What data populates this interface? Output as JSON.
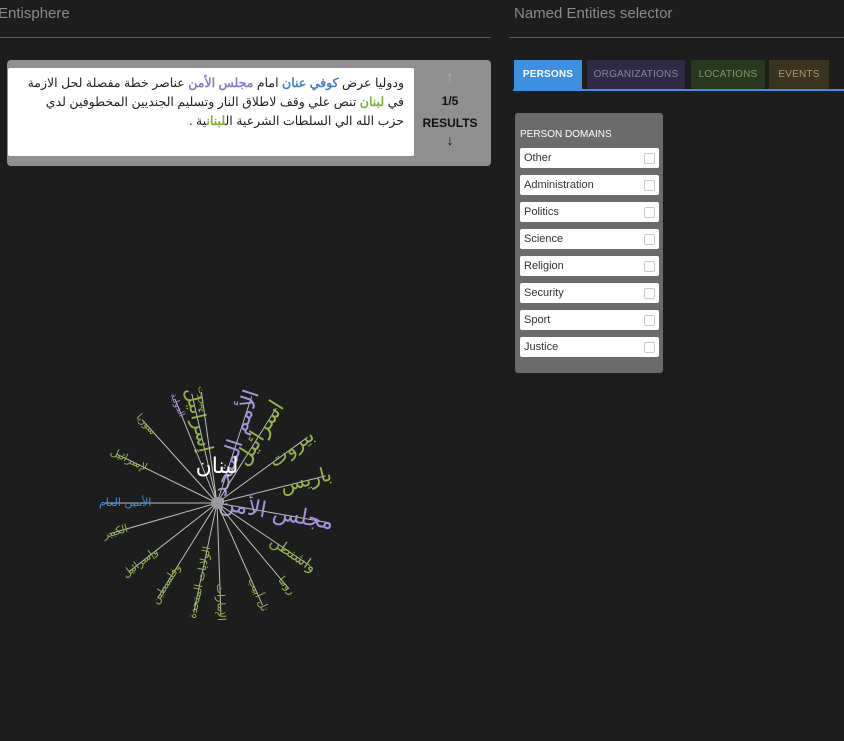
{
  "left_panel": {
    "title": "Entisphere",
    "result": {
      "sentence": {
        "part1": "ودوليا عرض ",
        "person": "كوفي عنان",
        "part2": " امام ",
        "org": "مجلس الأمن",
        "part3": " عناصر خطة مفصلة لحل الازمة في ",
        "loc1": "لبنان",
        "part4": " تنص علي وقف لاطلاق النار وتسليم الجنديين المخطوفين لدي حزب الله الي السلطات الشرعية ال",
        "loc2": "لبنان",
        "part5": "ية ."
      },
      "nav": {
        "up_icon": "arrow-up-icon",
        "up_glyph": "↑",
        "count": "1/5",
        "results_label": "RESULTS",
        "down_icon": "arrow-down-icon",
        "down_glyph": "↓"
      }
    },
    "sphere": {
      "center": "لبنان",
      "colors": {
        "center": "#ffffff",
        "spoke": "#bdbdbd",
        "location": "#93b34a",
        "organization": "#a593dd",
        "person": "#3d8fe0"
      },
      "entities": [
        {
          "text": "إسرائيل",
          "type": "location",
          "angle": -103,
          "size": 20
        },
        {
          "text": "الأمم المتحدة",
          "type": "organization",
          "angle": -72,
          "size": 22
        },
        {
          "text": "اسرائيل",
          "type": "location",
          "angle": -58,
          "size": 22
        },
        {
          "text": "بيروت",
          "type": "location",
          "angle": -36,
          "size": 20
        },
        {
          "text": "باريس",
          "type": "location",
          "angle": -14,
          "size": 20
        },
        {
          "text": "مجلس الأمن",
          "type": "organization",
          "angle": 10,
          "size": 22
        },
        {
          "text": "واشنطن",
          "type": "location",
          "angle": 34,
          "size": 15
        },
        {
          "text": "روما",
          "type": "location",
          "angle": 50,
          "size": 11
        },
        {
          "text": "تل أبيب",
          "type": "location",
          "angle": 66,
          "size": 11
        },
        {
          "text": "الإمارات",
          "type": "location",
          "angle": 88,
          "size": 11
        },
        {
          "text": "الولايات المتحدة",
          "type": "location",
          "angle": 102,
          "size": 11
        },
        {
          "text": "وفلسطين",
          "type": "location",
          "angle": 122,
          "size": 11
        },
        {
          "text": "وإسرائيل",
          "type": "location",
          "angle": 142,
          "size": 11
        },
        {
          "text": "الكبير",
          "type": "location",
          "angle": 164,
          "size": 11
        },
        {
          "text": "الأمين العام",
          "type": "person",
          "angle": 180,
          "size": 11
        },
        {
          "text": "لإسرائيل",
          "type": "location",
          "angle": 206,
          "size": 11
        },
        {
          "text": "سوريا",
          "type": "location",
          "angle": 228,
          "size": 10
        },
        {
          "text": "الدولية",
          "type": "organization",
          "angle": 248,
          "size": 9
        },
        {
          "text": "بيروت",
          "type": "location",
          "angle": 262,
          "size": 9
        }
      ]
    }
  },
  "right_panel": {
    "title": "Named Entities selector",
    "tabs": [
      {
        "label": "PERSONS"
      },
      {
        "label": "ORGANIZATIONS"
      },
      {
        "label": "LOCATIONS"
      },
      {
        "label": "EVENTS"
      }
    ],
    "domains": {
      "title": "PERSON DOMAINS",
      "items": [
        {
          "label": "Other"
        },
        {
          "label": "Administration"
        },
        {
          "label": "Politics"
        },
        {
          "label": "Science"
        },
        {
          "label": "Religion"
        },
        {
          "label": "Security"
        },
        {
          "label": "Sport"
        },
        {
          "label": "Justice"
        }
      ]
    }
  }
}
